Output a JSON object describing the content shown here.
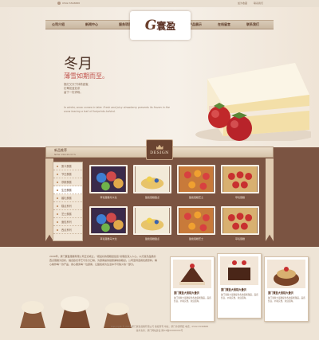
{
  "topbar": {
    "phone": "0592-5598888",
    "links": [
      "加为收藏",
      "联系我们"
    ]
  },
  "nav": {
    "items": [
      "公司介绍",
      "新闻中心",
      "服务项目",
      "产品展示",
      "在线留言",
      "联系我们"
    ]
  },
  "logo": {
    "g": "G",
    "cn": "寰盈"
  },
  "hero": {
    "title": "冬月",
    "subtitle": "薄雪如期而至。",
    "lines": [
      "推红艾天宁抹着甜蜜,",
      "红莓如蓝如浆",
      "留下一份清晰。"
    ],
    "english": "In winter, snow comes in later. Fresh and juicy strawberry presents its frozen in the snow leaving a trail of footprints behind."
  },
  "design_badge": "DESIGN",
  "new_products": {
    "title_cn": "新品推荐",
    "title_en": "NEW PRODUCTS"
  },
  "sidebar": {
    "items": [
      "蛋卡蛋糕",
      "节日蛋糕",
      "慕斯蛋糕",
      "生日蛋糕",
      "婚礼蛋糕",
      "糕点系列",
      "芝士蛋糕",
      "面包系列",
      "西点系列"
    ],
    "active_index": 3
  },
  "products": [
    {
      "caption": "草莓蛋糕马卡龙"
    },
    {
      "caption": "甜蜜蛋糕甜点"
    },
    {
      "caption": "甜蜜蛋糕芝士"
    },
    {
      "caption": "草莓蛋糕"
    },
    {
      "caption": "草莓蛋糕马卡龙"
    },
    {
      "caption": "甜蜜蛋糕甜点"
    },
    {
      "caption": "甜蜜蛋糕芝士"
    },
    {
      "caption": "草莓蛋糕"
    }
  ],
  "about": {
    "text": "2009年，厦门寰盈蛋糕有限公司正式成立，\"把最好的蛋糕送给您\"的理念深入人心。以打造高品质的西点蛋糕为目标，融合欧式手艺与东方口味，为顾客提供健康美味的糕点。公司坚持选用优质原料，精心制作每一款产品，用心服务每一位顾客，让甜蜜成为生活中不可缺少的一部分。"
  },
  "cards": [
    {
      "title": "厦门寰盈大蛋糕大量供",
      "text": "厦门寰盈大蛋糕提供各类蛋糕甜品，品质优良，价格实惠，欢迎选购。"
    },
    {
      "title": "厦门寰盈大蛋糕大量供",
      "text": "厦门寰盈大蛋糕提供各类蛋糕甜品，品质优良，价格实惠，欢迎选购。"
    },
    {
      "title": "厦门寰盈大蛋糕大量供",
      "text": "厦门寰盈大蛋糕提供各类蛋糕甜品，品质优良，价格实惠，欢迎选购。"
    }
  ],
  "footer": {
    "line1": "Copyright © 2014  厦门寰盈蛋糕有限公司 版权所有  地址：厦门市思明区  电话：0592-5598888",
    "line2": "技术支持：厦门网站建设  闽ICP备00000000号"
  }
}
